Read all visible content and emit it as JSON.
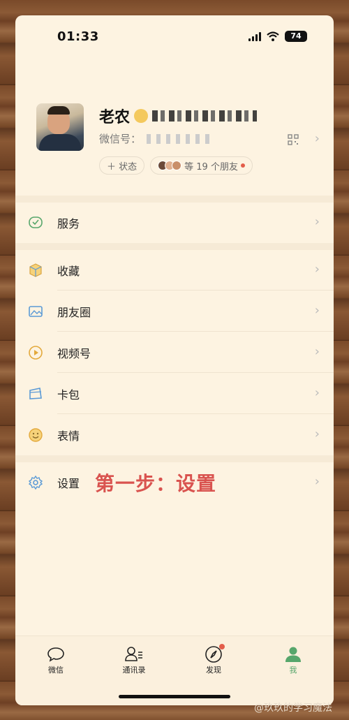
{
  "status": {
    "time": "01:33",
    "battery": "74"
  },
  "profile": {
    "name": "老农",
    "wechat_id_label": "微信号：",
    "status_button": "＋ 状态",
    "friends_text": "等 19 个朋友"
  },
  "menu": [
    {
      "label": "服务",
      "icon": "wechat-pay-icon"
    },
    {
      "label": "收藏",
      "icon": "favorites-cube-icon"
    },
    {
      "label": "朋友圈",
      "icon": "moments-image-icon"
    },
    {
      "label": "视频号",
      "icon": "channels-play-icon"
    },
    {
      "label": "卡包",
      "icon": "card-wallet-icon"
    },
    {
      "label": "表情",
      "icon": "sticker-smile-icon"
    },
    {
      "label": "设置",
      "icon": "gear-icon"
    }
  ],
  "annotation": "第一步：设置",
  "tabs": [
    {
      "label": "微信",
      "icon": "chat-bubble-icon"
    },
    {
      "label": "通讯录",
      "icon": "contacts-icon"
    },
    {
      "label": "发现",
      "icon": "compass-icon"
    },
    {
      "label": "我",
      "icon": "person-icon"
    }
  ],
  "watermark": "@玖玖的学习魔法",
  "colors": {
    "accent": "#57a66b",
    "annotation": "#d9534f",
    "background": "#fdf3e1"
  }
}
